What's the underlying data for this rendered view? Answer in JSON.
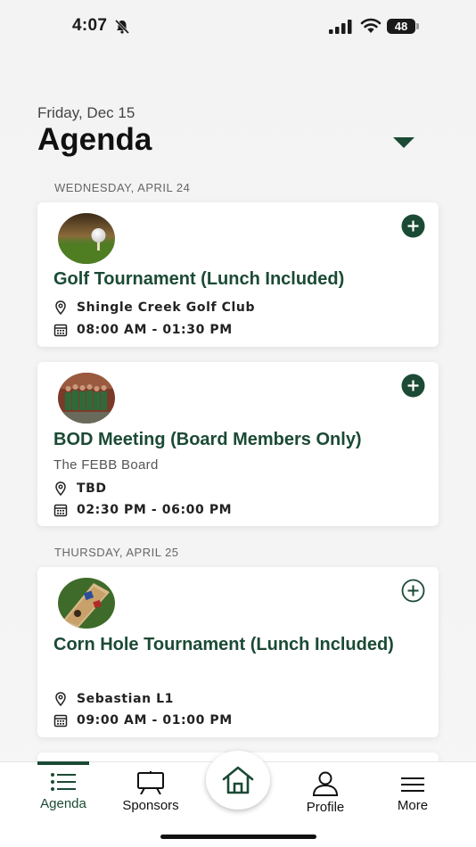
{
  "status_bar": {
    "time": "4:07",
    "battery": "48",
    "battery_level": 0.48
  },
  "header": {
    "date": "Friday, Dec 15",
    "title": "Agenda"
  },
  "colors": {
    "accent": "#1b4a35",
    "text": "#111111",
    "muted": "#666666"
  },
  "sections": [
    {
      "label": "WEDNESDAY, APRIL 24",
      "events": [
        {
          "title": "Golf Tournament (Lunch Included)",
          "location": "Shingle Creek Golf Club",
          "time": "08:00 AM - 01:30 PM",
          "added": false,
          "image": "golf-ball-on-tee"
        },
        {
          "title": "BOD Meeting (Board Members Only)",
          "subtitle": "The FEBB Board",
          "location": "TBD",
          "time": "02:30 PM - 06:00 PM",
          "added": false,
          "image": "group-photo"
        }
      ]
    },
    {
      "label": "THURSDAY, APRIL 25",
      "events": [
        {
          "title": "Corn Hole Tournament (Lunch Included)",
          "location": "Sebastian L1",
          "time": "09:00 AM - 01:00 PM",
          "added": false,
          "image": "cornhole-board"
        }
      ]
    }
  ],
  "tabs": [
    {
      "label": "Agenda",
      "icon": "list-icon",
      "active": true
    },
    {
      "label": "Sponsors",
      "icon": "easel-icon",
      "active": false
    },
    {
      "label": "Home",
      "icon": "home-icon",
      "active": false
    },
    {
      "label": "Profile",
      "icon": "person-icon",
      "active": false
    },
    {
      "label": "More",
      "icon": "hamburger-icon",
      "active": false
    }
  ]
}
